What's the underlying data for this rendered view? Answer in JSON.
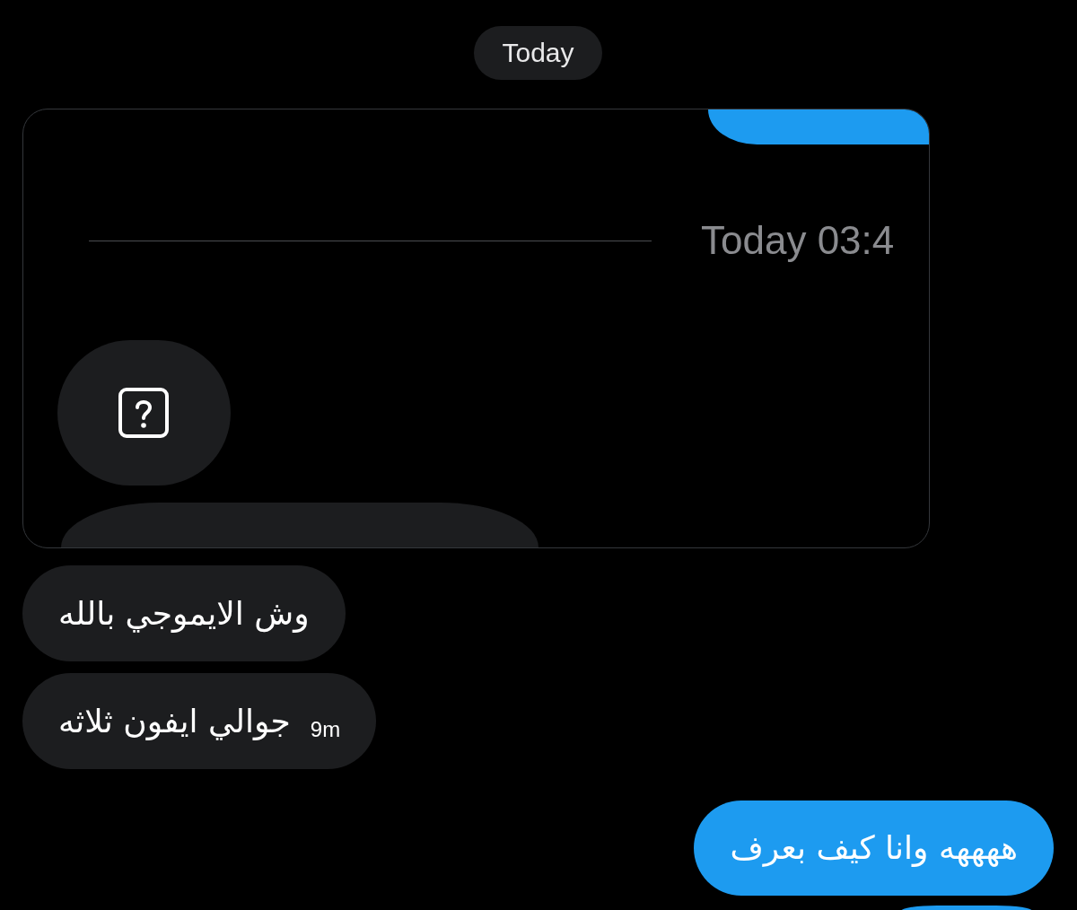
{
  "date_separator": {
    "label": "Today"
  },
  "embedded_screenshot": {
    "items": [
      {
        "kind": "sent_bubble_cut"
      },
      {
        "kind": "time_divider",
        "label": "Today 03:4"
      },
      {
        "kind": "emoji_bubble"
      },
      {
        "kind": "received_bubble_cut"
      }
    ]
  },
  "messages": [
    {
      "kind": "received",
      "text": "وش الايموجي بالله"
    },
    {
      "kind": "received",
      "text": "جوالي ايفون ثلاثه",
      "time": "9m"
    },
    {
      "kind": "sent",
      "text": "ههههه وانا كيف بعرف"
    },
    {
      "kind": "sent_cut"
    }
  ]
}
